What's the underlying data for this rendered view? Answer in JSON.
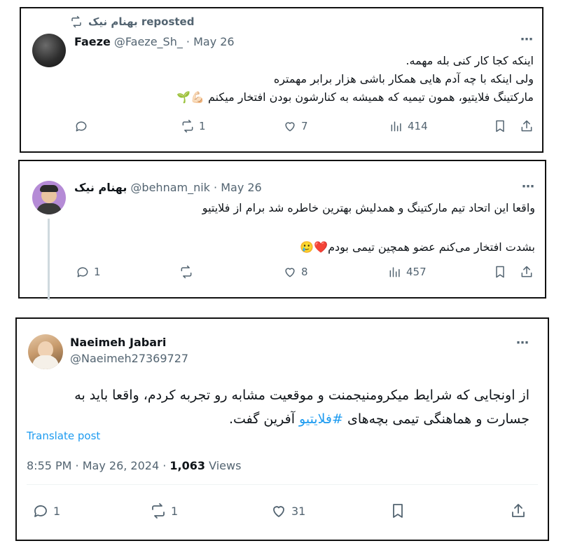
{
  "tweet1": {
    "repost_label": "بهنام نیک reposted",
    "author_name": "Faeze",
    "handle_date": "@Faeze_Sh_ · May 26",
    "lines": [
      "اینکه کجا کار کنی بله مهمه.",
      "ولی اینکه با چه آدم هایی همکار باشی هزار برابر مهمتره",
      "مارکتینگ فلایتیو، همون تیمیه که همیشه به کنارشون بودن افتخار میکنم 💪🏻🌱"
    ],
    "replies": "",
    "reposts": "1",
    "likes": "7",
    "views": "414"
  },
  "tweet2": {
    "author_name": "بهنام نیک",
    "handle_date": "@behnam_nik · May 26",
    "lines": [
      "واقعا این اتحاد تیم مارکتینگ و همدلیش بهترین خاطره شد برام از فلایتیو",
      "بشدت افتخار می‌کنم عضو همچین تیمی بودم❤️🥲"
    ],
    "replies": "1",
    "reposts": "",
    "likes": "8",
    "views": "457"
  },
  "tweet3": {
    "author_name": "Naeimeh Jabari",
    "handle": "@Naeimeh27369727",
    "line1": "از اونجایی که شرایط میکرومنیجمنت و موقعیت مشابه رو تجربه کردم، واقعا باید به",
    "line2_before": "جسارت و هماهنگی تیمی بچه‌های ",
    "line2_hashtag": "#فلایتیو",
    "line2_after": " آفرین گفت.",
    "translate": "Translate post",
    "time_date": "8:55 PM · May 26, 2024 · ",
    "views_count": "1,063",
    "views_label": " Views",
    "replies": "1",
    "reposts": "1",
    "likes": "31"
  },
  "icons": {
    "more": "⋯"
  }
}
